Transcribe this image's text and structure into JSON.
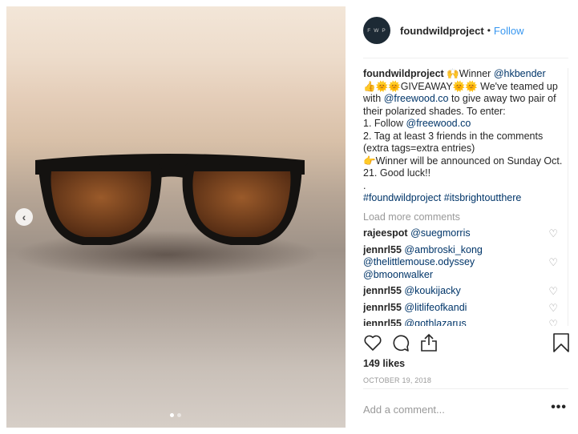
{
  "post": {
    "image_alt": "sunglasses on sand",
    "carousel_index": 1,
    "carousel_count": 2
  },
  "header": {
    "avatar_text": "FWP",
    "username": "foundwildproject",
    "separator": "•",
    "follow_label": "Follow"
  },
  "caption": {
    "username": "foundwildproject",
    "emoji1": "🙌",
    "t1": "Winner ",
    "m1": "@hkbender",
    "line2_emoji": "👍🌞🌞",
    "t2": "GIVEAWAY",
    "emoji3": "🌞🌞",
    "t3": " We've teamed up with ",
    "m2": "@freewood.co",
    "t4": " to give away two pair of their polarized shades. To enter:",
    "t5": "1. Follow ",
    "m3": "@freewood.co",
    "t6": "2. Tag at least 3 friends in the comments (extra tags=extra entries)",
    "emoji4": "👉",
    "t7": "Winner will be announced on Sunday Oct. 21. Good luck!!",
    "t8": ".",
    "hashtags": "#foundwildproject #itsbrightoutthere"
  },
  "load_more": "Load more comments",
  "comments": [
    {
      "user": "rajeespot",
      "text": "@suegmorris"
    },
    {
      "user": "jennrl55",
      "text": "@ambroski_kong @thelittlemouse.odyssey @bmoonwalker"
    },
    {
      "user": "jennrl55",
      "text": "@koukijacky"
    },
    {
      "user": "jennrl55",
      "text": "@litlifeofkandi"
    },
    {
      "user": "jennrl55",
      "text": "@gothlazarus"
    }
  ],
  "likes": "149 likes",
  "date": "OCTOBER 19, 2018",
  "add_comment_placeholder": "Add a comment...",
  "options": "•••",
  "colors": {
    "link": "#003569",
    "follow": "#3897f0"
  }
}
